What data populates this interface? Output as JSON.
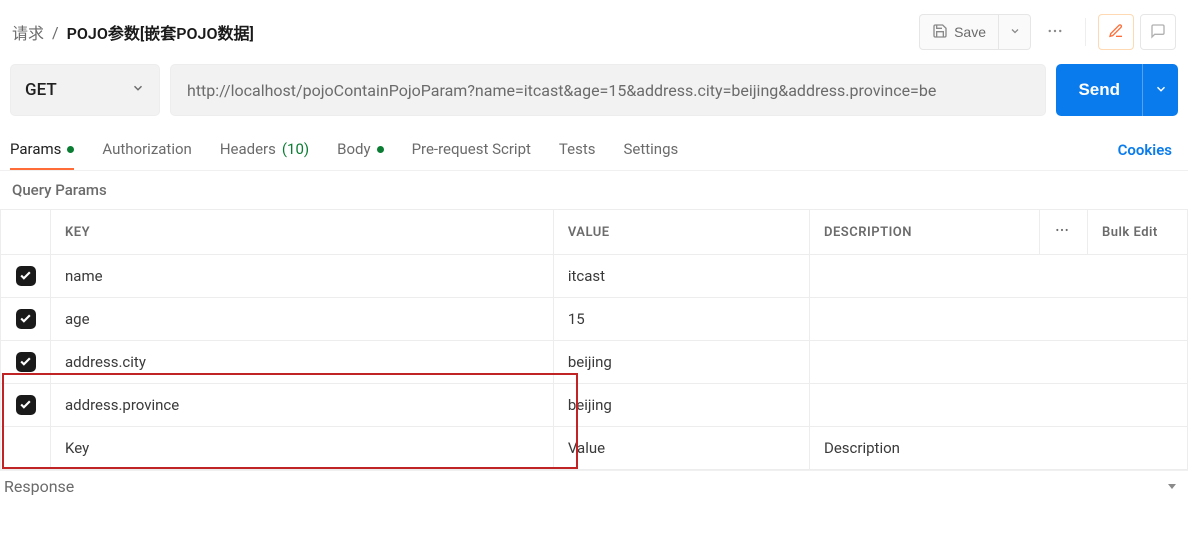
{
  "breadcrumb": {
    "parent": "请求",
    "title": "POJO参数[嵌套POJO数据]"
  },
  "toolbar": {
    "save": "Save"
  },
  "method": "GET",
  "url": "http://localhost/pojoContainPojoParam?name=itcast&age=15&address.city=beijing&address.province=be",
  "send": "Send",
  "tabs": {
    "params": "Params",
    "authorization": "Authorization",
    "headers": "Headers",
    "headers_count": "(10)",
    "body": "Body",
    "prerequest": "Pre-request Script",
    "tests": "Tests",
    "settings": "Settings",
    "cookies": "Cookies"
  },
  "section": {
    "query_params": "Query Params"
  },
  "table": {
    "headers": {
      "key": "KEY",
      "value": "VALUE",
      "description": "DESCRIPTION",
      "bulk": "Bulk Edit"
    },
    "rows": [
      {
        "checked": true,
        "key": "name",
        "value": "itcast",
        "description": ""
      },
      {
        "checked": true,
        "key": "age",
        "value": "15",
        "description": ""
      },
      {
        "checked": true,
        "key": "address.city",
        "value": "beijing",
        "description": ""
      },
      {
        "checked": true,
        "key": "address.province",
        "value": "beijing",
        "description": ""
      }
    ],
    "placeholder": {
      "key": "Key",
      "value": "Value",
      "description": "Description"
    }
  },
  "response": "Response",
  "more_dots": "◦◦◦"
}
